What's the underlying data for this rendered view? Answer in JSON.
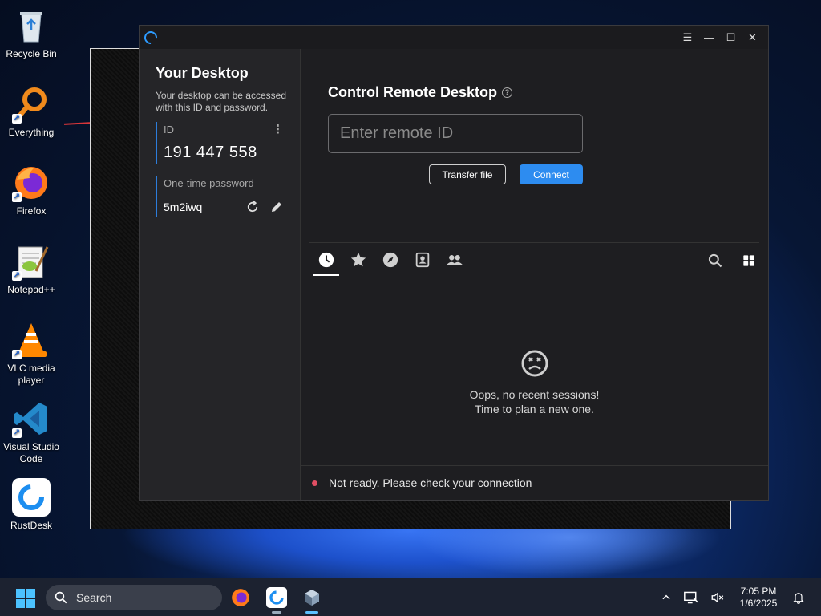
{
  "desktop": {
    "icons": [
      {
        "label": "Recycle Bin",
        "icon": "recycle-bin-icon"
      },
      {
        "label": "Everything",
        "icon": "everything-search-icon"
      },
      {
        "label": "Firefox",
        "icon": "firefox-icon"
      },
      {
        "label": "Notepad++",
        "icon": "notepad-plus-plus-icon"
      },
      {
        "label": "VLC media player",
        "icon": "vlc-icon"
      },
      {
        "label": "Visual Studio Code",
        "icon": "vscode-icon"
      },
      {
        "label": "RustDesk",
        "icon": "rustdesk-icon"
      }
    ]
  },
  "window": {
    "controls": {
      "menu": "☰",
      "minimize": "—",
      "maximize": "☐",
      "close": "✕"
    }
  },
  "sidebar": {
    "title": "Your Desktop",
    "description": "Your desktop can be accessed with this ID and password.",
    "id_label": "ID",
    "id_value": "191 447 558",
    "password_label": "One-time password",
    "password_value": "5m2iwq"
  },
  "connect": {
    "title": "Control Remote Desktop",
    "input_placeholder": "Enter remote ID",
    "transfer_label": "Transfer file",
    "connect_label": "Connect"
  },
  "tabs": [
    {
      "name": "recent-sessions",
      "icon": "clock-icon",
      "active": true
    },
    {
      "name": "favorites",
      "icon": "star-icon",
      "active": false
    },
    {
      "name": "discovered",
      "icon": "compass-icon",
      "active": false
    },
    {
      "name": "address-book",
      "icon": "contact-card-icon",
      "active": false
    },
    {
      "name": "group",
      "icon": "people-icon",
      "active": false
    }
  ],
  "empty_state": {
    "line1": "Oops, no recent sessions!",
    "line2": "Time to plan a new one."
  },
  "status": {
    "text": "Not ready. Please check your connection",
    "color": "#e14e63"
  },
  "taskbar": {
    "search_label": "Search",
    "time": "7:05 PM",
    "date": "1/6/2025"
  },
  "colors": {
    "accent": "#2d8cf0",
    "window_bg": "#1e1e21",
    "sidebar_bg": "#252528"
  }
}
